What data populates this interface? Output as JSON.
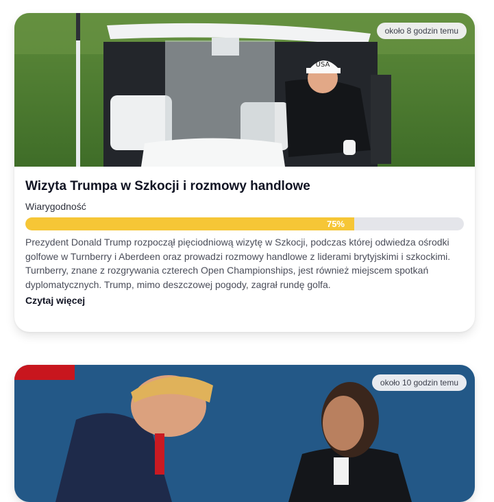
{
  "articles": [
    {
      "time": "około 8 godzin temu",
      "title": "Wizyta Trumpa w Szkocji i rozmowy handlowe",
      "credibility_label": "Wiarygodność",
      "credibility_value": 0.75,
      "credibility_text": "75%",
      "description": "Prezydent Donald Trump rozpoczął pięciodniową wizytę w Szkocji, podczas której odwiedza ośrodki golfowe w Turnberry i Aberdeen oraz prowadzi rozmowy handlowe z liderami brytyjskimi i szkockimi. Turnberry, znane z rozgrywania czterech Open Championships, jest również miejscem spotkań dyplomatycznych. Trump, mimo deszczowej pogody, zagrał rundę golfa.",
      "read_more": "Czytaj więcej",
      "image_text": "USA"
    },
    {
      "time": "około 10 godzin temu"
    }
  ],
  "colors": {
    "bar_fill": "#f6c636",
    "bar_track": "#e4e5ea"
  }
}
